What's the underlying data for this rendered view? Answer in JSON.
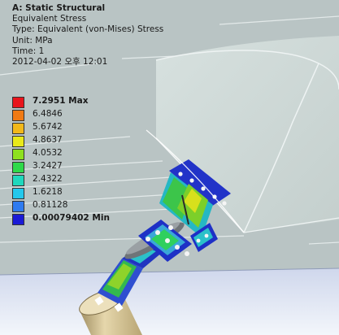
{
  "header": {
    "title": "A: Static Structural",
    "result_name": "Equivalent Stress",
    "type_line": "Type: Equivalent (von-Mises) Stress",
    "unit_line": "Unit: MPa",
    "time_line": "Time: 1",
    "date_line": "2012-04-02 오후 12:01"
  },
  "legend": {
    "entries": [
      {
        "label": "7.2951 Max",
        "color": "#e8151c",
        "bold": true
      },
      {
        "label": "6.4846",
        "color": "#f07a14",
        "bold": false
      },
      {
        "label": "5.6742",
        "color": "#f2b81a",
        "bold": false
      },
      {
        "label": "4.8637",
        "color": "#e9e91a",
        "bold": false
      },
      {
        "label": "4.0532",
        "color": "#8ee01e",
        "bold": false
      },
      {
        "label": "3.2427",
        "color": "#2fd94a",
        "bold": false
      },
      {
        "label": "2.4322",
        "color": "#1fd8bd",
        "bold": false
      },
      {
        "label": "1.6218",
        "color": "#23c8ec",
        "bold": false
      },
      {
        "label": "0.81128",
        "color": "#2e7bf0",
        "bold": false
      },
      {
        "label": "0.00079402 Min",
        "color": "#1a1ad6",
        "bold": true
      }
    ]
  },
  "colors": {
    "background": "#b9c4c4",
    "hull_surface": "#cdd8d6",
    "floor": "#e4ebf7",
    "ground": "#b0bcbb",
    "edge_line": "#f2f5f5"
  }
}
